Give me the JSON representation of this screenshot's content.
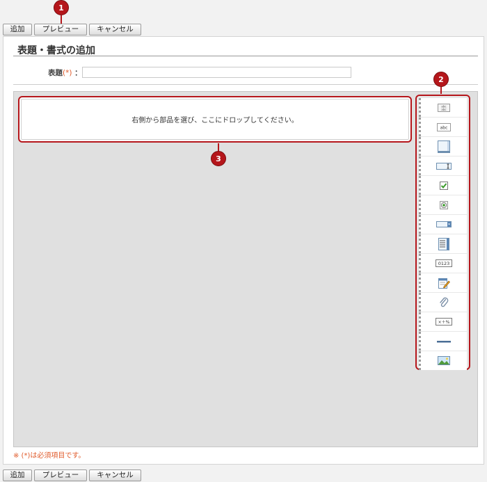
{
  "toolbar": {
    "add_label": "追加",
    "preview_label": "プレビュー",
    "cancel_label": "キャンセル"
  },
  "markers": {
    "m1": "1",
    "m2": "2",
    "m3": "3"
  },
  "form": {
    "page_title": "表題・書式の追加",
    "title_field_label": "表題",
    "required_mark": "(*)",
    "label_colon": "：",
    "title_value": ""
  },
  "canvas": {
    "drop_hint": "右側から部品を選び、ここにドロップしてください。"
  },
  "palette": {
    "items": [
      {
        "icon": "static-text-icon",
        "text": "abc"
      },
      {
        "icon": "label-text-icon",
        "text": "abc"
      },
      {
        "icon": "textarea-icon"
      },
      {
        "icon": "text-input-icon"
      },
      {
        "icon": "checkbox-icon"
      },
      {
        "icon": "radio-button-icon"
      },
      {
        "icon": "dropdown-icon"
      },
      {
        "icon": "list-box-icon"
      },
      {
        "icon": "number-field-icon",
        "text": "0123"
      },
      {
        "icon": "date-memo-icon"
      },
      {
        "icon": "attachment-icon"
      },
      {
        "icon": "calculation-icon",
        "text": "×＋%"
      },
      {
        "icon": "horizontal-line-icon"
      },
      {
        "icon": "image-icon"
      }
    ]
  },
  "footer": {
    "required_note": "※ (*)は必須項目です。"
  },
  "colors": {
    "marker": "#b5161b",
    "required": "#e05a2a",
    "canvas_bg": "#e0e0e0"
  }
}
